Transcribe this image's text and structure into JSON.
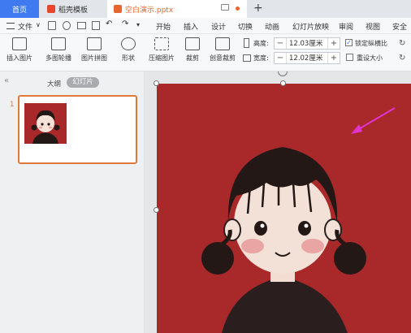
{
  "tabs": {
    "home": "首页",
    "templates": "稻壳模板",
    "document": "空白演示.pptx"
  },
  "menu": {
    "file": "文件",
    "items": [
      "开始",
      "插入",
      "设计",
      "切换",
      "动画",
      "幻灯片放映",
      "审阅",
      "视图",
      "安全"
    ]
  },
  "toolbar": {
    "insert_picture": "插入图片",
    "multi_outline": "多图轮播",
    "picture_collage": "图片拼图",
    "shape": "形状",
    "compress_picture": "压缩图片",
    "crop": "裁剪",
    "creative_crop": "创意裁剪",
    "height_label": "高度:",
    "height_value": "12.03厘米",
    "width_label": "宽度:",
    "width_value": "12.02厘米",
    "lock_ratio": "锁定纵横比",
    "reset_size": "重设大小"
  },
  "left_pane": {
    "outline_tab": "大纲",
    "slides_tab": "幻灯片",
    "slide_number": "1"
  },
  "colors": {
    "accent": "#3f7af0",
    "slide_bg": "#a9282a",
    "thumb_border": "#e07a3a",
    "annotation_arrow": "#e033d0"
  }
}
